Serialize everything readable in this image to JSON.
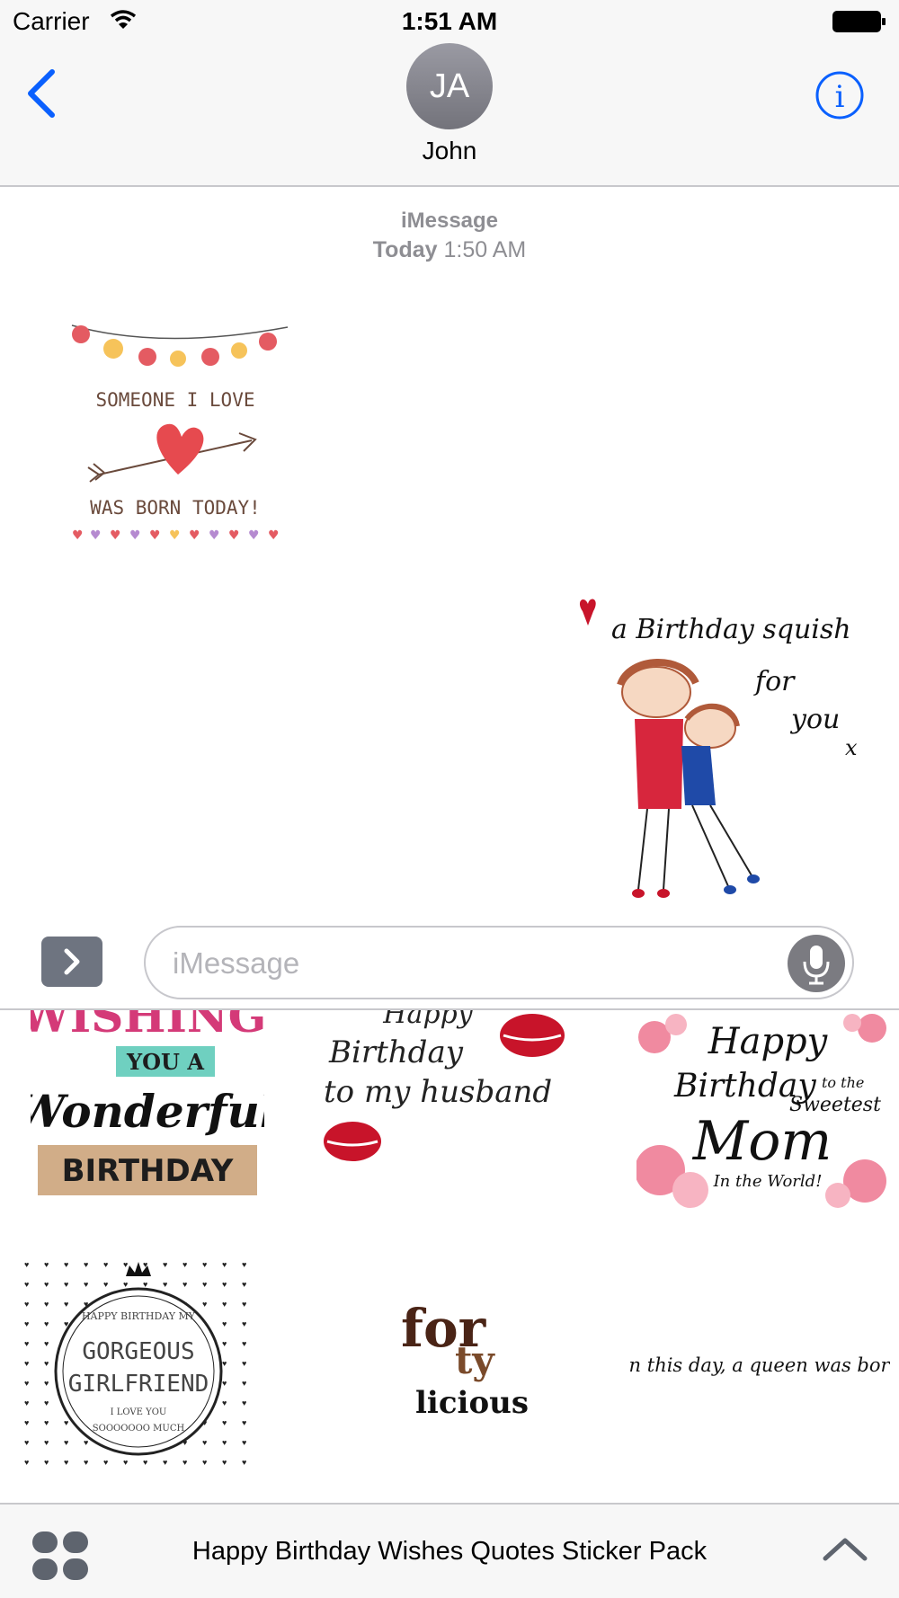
{
  "status_bar": {
    "carrier": "Carrier",
    "time": "1:51 AM"
  },
  "nav": {
    "avatar_initials": "JA",
    "contact_name": "John"
  },
  "conversation": {
    "service": "iMessage",
    "timestamp_day": "Today",
    "timestamp_time": "1:50 AM",
    "received_sticker": {
      "line1": "SOMEONE I LOVE",
      "line2": "WAS BORN TODAY!"
    },
    "sent_sticker": {
      "line1": "a Birthday squish",
      "line2": "for",
      "line3": "you",
      "mark": "x"
    }
  },
  "input": {
    "placeholder": "iMessage"
  },
  "drawer": {
    "stickers": [
      {
        "line1": "WISHING",
        "line2": "YOU A",
        "line3": "Wonderful",
        "line4": "BIRTHDAY"
      },
      {
        "line1": "Happy",
        "line2": "Birthday",
        "line3": "to my husband"
      },
      {
        "line1": "Happy",
        "line2": "Birthday",
        "line3": "to the",
        "line4": "Sweetest",
        "line5": "Mom",
        "line6": "In the World!"
      },
      {
        "line1": "HAPPY BIRTHDAY MY",
        "line2": "GORGEOUS",
        "line3": "GIRLFRIEND",
        "line4": "I LOVE YOU",
        "line5": "SOOOOOOO MUCH"
      },
      {
        "line1": "for",
        "line2": "ty",
        "line3": "licious"
      },
      {
        "line1": "on this day, a queen was born"
      }
    ],
    "pack_title": "Happy Birthday Wishes Quotes Sticker Pack"
  },
  "colors": {
    "accent": "#0a60fe",
    "gray": "#8e8e93",
    "bar_bg": "#f7f7f7"
  }
}
